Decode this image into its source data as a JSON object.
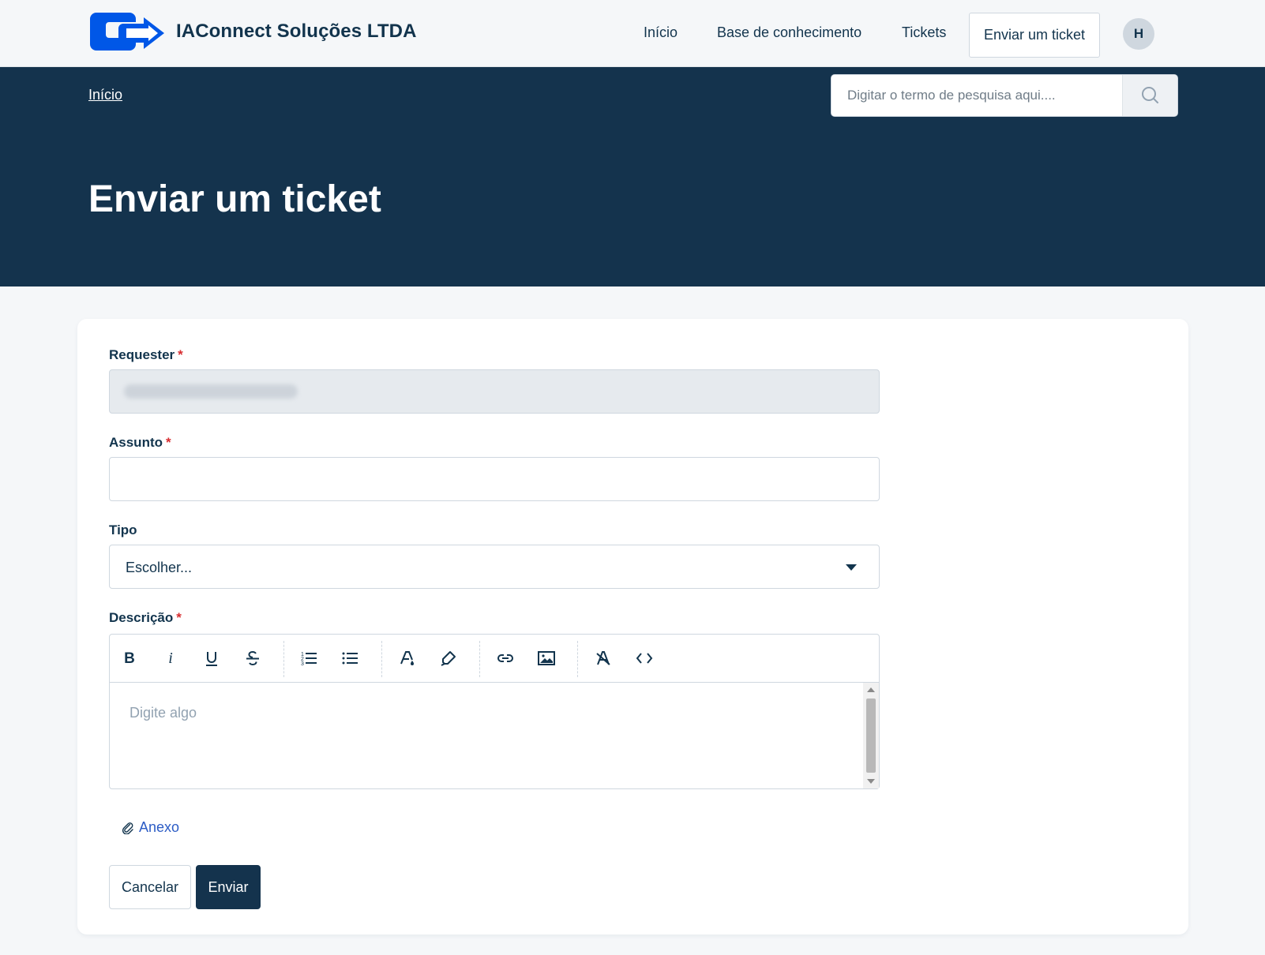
{
  "header": {
    "brand": "IAConnect Soluções LTDA",
    "nav": [
      "Início",
      "Base de conhecimento",
      "Tickets"
    ],
    "submit_button": "Enviar um ticket",
    "avatar_initial": "H"
  },
  "hero": {
    "breadcrumb": "Início",
    "search_placeholder": "Digitar o termo de pesquisa aqui....",
    "title": "Enviar um ticket"
  },
  "form": {
    "requester_label": "Requester",
    "subject_label": "Assunto",
    "type_label": "Tipo",
    "type_value": "Escolher...",
    "description_label": "Descrição",
    "description_placeholder": "Digite algo",
    "required_mark": "*",
    "attachment_label": "Anexo",
    "cancel_label": "Cancelar",
    "submit_label": "Enviar"
  },
  "colors": {
    "primary_dark": "#14334d",
    "accent_blue": "#0057e7",
    "link_blue": "#2c5cc5",
    "required_red": "#d72d30"
  },
  "editor_toolbar": [
    "bold-icon",
    "italic-icon",
    "underline-icon",
    "strikethrough-icon",
    "ordered-list-icon",
    "bullet-list-icon",
    "text-color-icon",
    "highlight-icon",
    "link-icon",
    "image-icon",
    "clear-format-icon",
    "code-view-icon"
  ]
}
